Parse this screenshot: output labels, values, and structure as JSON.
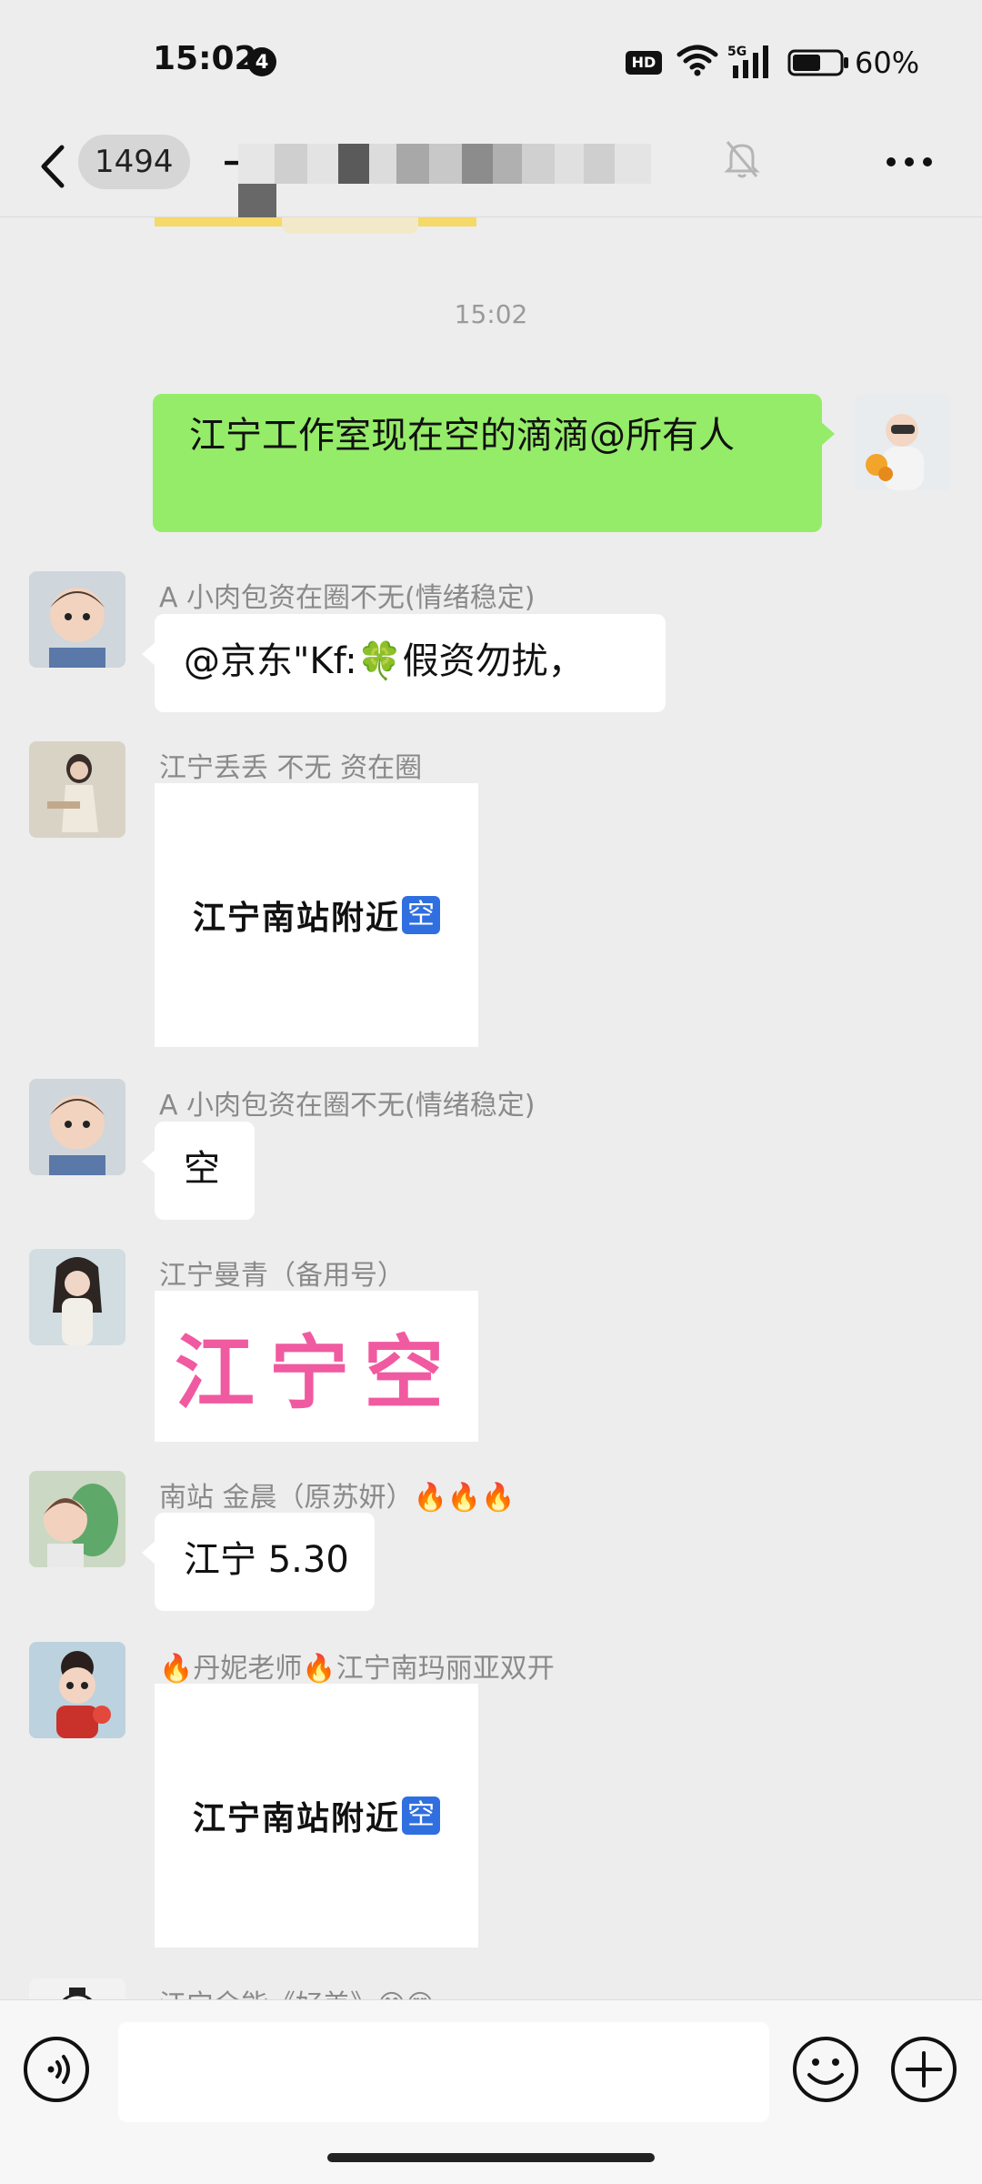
{
  "status_bar": {
    "time": "15:02",
    "notification_count": "4",
    "hd_label": "HD",
    "network_label": "5G",
    "battery_percent": "60%",
    "battery_level": 0.6,
    "icons": [
      "hd-icon",
      "wifi-icon",
      "signal-5g-icon",
      "battery-icon"
    ]
  },
  "nav_bar": {
    "unread_count": "1494",
    "title_partial": "一",
    "icons": [
      "back-chevron-icon",
      "mute-bell-icon",
      "more-icon"
    ]
  },
  "chat": {
    "timestamp": "15:02",
    "messages": [
      {
        "side": "right",
        "type": "text",
        "text": "江宁工作室现在空的滴滴@所有人"
      },
      {
        "side": "left",
        "sender": "A    小肉包资在圈不无(情绪稳定)",
        "type": "text",
        "text": "@京东\"Kf:🍀假资勿扰，"
      },
      {
        "side": "left",
        "sender": "江宁丢丢 不无 资在圈",
        "type": "image",
        "text": "江宁南站附近",
        "badge": "空"
      },
      {
        "side": "left",
        "sender": "A    小肉包资在圈不无(情绪稳定)",
        "type": "text",
        "text": "空"
      },
      {
        "side": "left",
        "sender": "江宁曼青（备用号）",
        "type": "image",
        "text": "江宁空"
      },
      {
        "side": "left",
        "sender": "南站 金晨（原苏妍）🔥🔥🔥",
        "type": "text",
        "text": "江宁 5.30"
      },
      {
        "side": "left",
        "sender": "🔥丹妮老师🔥江宁南玛丽亚双开",
        "type": "image",
        "text": "江宁南站附近",
        "badge": "空"
      },
      {
        "side": "left",
        "sender": "江宁余能《好美》😊😍",
        "type": "partial"
      }
    ]
  },
  "input_bar": {
    "placeholder": "",
    "icons": [
      "voice-icon",
      "emoji-icon",
      "plus-icon"
    ]
  },
  "colors": {
    "background": "#ededed",
    "outgoing_bubble": "#95ec69",
    "incoming_bubble": "#ffffff",
    "sticker_pink": "#f05aa0"
  }
}
